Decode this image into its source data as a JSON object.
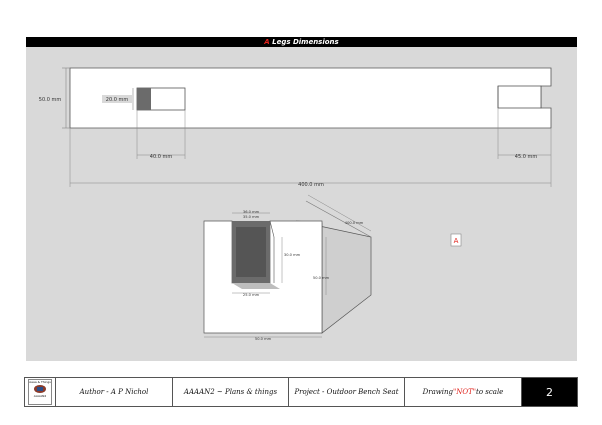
{
  "header": {
    "title_marker": "A",
    "title_rest": " Legs Dimensions"
  },
  "top_view": {
    "height_label": "50.0 mm",
    "slot_depth_label": "20.0 mm",
    "slot_width_label": "40.0 mm",
    "notch_length_label": "45.0 mm",
    "total_length_label": "400.0 mm"
  },
  "iso_view": {
    "label_a": "36.0 mm",
    "label_b": "35.0 mm",
    "label_c": "400.0 mm",
    "label_d": "30.0 mm",
    "label_e": "50.0 mm",
    "label_f": "25.0 mm",
    "label_g": "50.0 mm"
  },
  "part_marker": "A",
  "logo": {
    "line1": "Aaaa & Things",
    "line2": "AAAAN2"
  },
  "footer": {
    "author": "Author - A P Nichol",
    "brand": "AAAAN2 ~ Plans & things",
    "project": "Project - Outdoor Bench Seat",
    "drawing_prefix": "Drawing ",
    "drawing_not": "\"NOT\"",
    "drawing_suffix": "to scale",
    "page_number": "2"
  },
  "colors": {
    "title_bar": "#000000",
    "accent_red": "#e0201a",
    "drawing_background": "#d9d9d9",
    "part_face": "#ffffff",
    "part_side": "#cfcfcf",
    "slot_shadow": "#6b6b6b"
  }
}
